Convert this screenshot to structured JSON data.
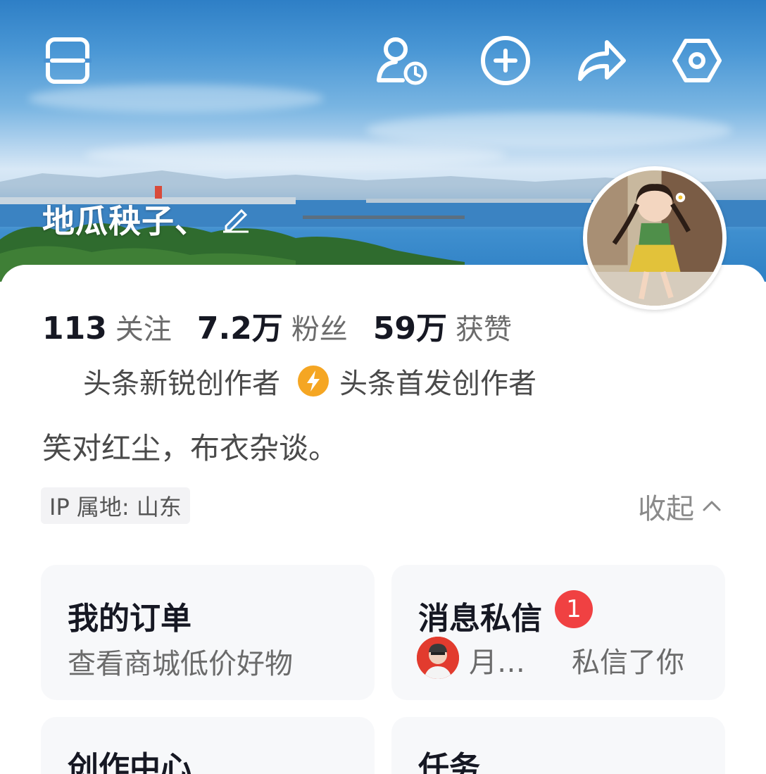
{
  "header": {
    "icons": [
      "menu-icon",
      "visitor-history-icon",
      "add-icon",
      "share-icon",
      "settings-icon"
    ],
    "username": "地瓜秧子、"
  },
  "stats": [
    {
      "value": "113",
      "label": "关注"
    },
    {
      "value": "7.2万",
      "label": "粉丝"
    },
    {
      "value": "59万",
      "label": "获赞"
    }
  ],
  "badges": {
    "first": "头条新锐创作者",
    "second": "头条首发创作者",
    "second_icon_color": "#f5a623"
  },
  "bio": "笑对红尘，布衣杂谈。",
  "ip_location": "IP 属地: 山东",
  "collapse_label": "收起",
  "tiles": {
    "orders": {
      "title": "我的订单",
      "subtitle": "查看商城低价好物"
    },
    "messages": {
      "title": "消息私信",
      "badge_count": "1",
      "sender": "月…",
      "text": "私信了你"
    },
    "creation": {
      "title": "创作中心"
    },
    "tasks": {
      "title": "任务"
    }
  },
  "colors": {
    "badge_red": "#f04142",
    "text_primary": "#161823",
    "text_secondary": "#6b6b6b"
  }
}
